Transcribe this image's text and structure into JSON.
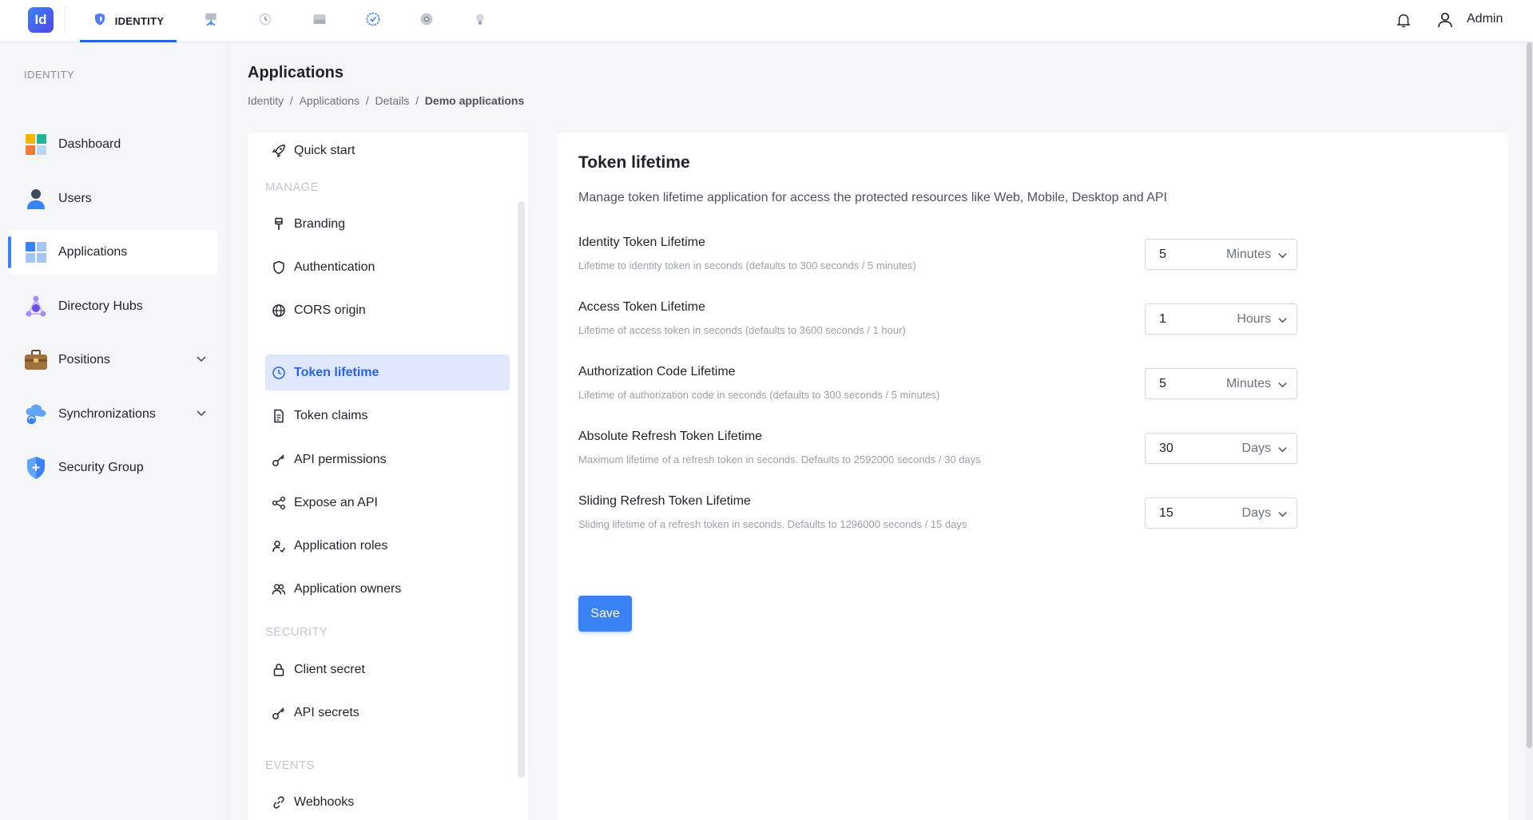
{
  "topbar": {
    "logo_text": "Id",
    "tabs": [
      {
        "name": "shield-icon",
        "label": "IDENTITY"
      },
      {
        "name": "network-icon",
        "label": ""
      },
      {
        "name": "history-icon",
        "label": ""
      },
      {
        "name": "storage-icon",
        "label": ""
      },
      {
        "name": "badge-check-icon",
        "label": ""
      },
      {
        "name": "gear-icon",
        "label": ""
      },
      {
        "name": "lightbulb-icon",
        "label": ""
      }
    ],
    "user_label": "Admin"
  },
  "sidebar": {
    "section": "IDENTITY",
    "items": [
      {
        "label": "Dashboard",
        "icon": "dashboard-icon"
      },
      {
        "label": "Users",
        "icon": "user-icon"
      },
      {
        "label": "Applications",
        "icon": "applications-icon",
        "active": true
      },
      {
        "label": "Directory Hubs",
        "icon": "hub-icon"
      },
      {
        "label": "Positions",
        "icon": "briefcase-icon",
        "expandable": true
      },
      {
        "label": "Synchronizations",
        "icon": "cloud-sync-icon",
        "expandable": true
      },
      {
        "label": "Security Group",
        "icon": "security-shield-icon"
      }
    ]
  },
  "header": {
    "title": "Applications",
    "breadcrumb": [
      "Identity",
      "Applications",
      "Details",
      "Demo applications"
    ],
    "separator": "/"
  },
  "nav": {
    "quick_start": "Quick start",
    "sections": {
      "manage": "MANAGE",
      "security": "SECURITY",
      "events": "EVENTS"
    },
    "manage_items": [
      "Branding",
      "Authentication",
      "CORS origin",
      "Token lifetime",
      "Token claims",
      "API permissions",
      "Expose an API",
      "Application roles",
      "Application owners"
    ],
    "security_items": [
      "Client secret",
      "API secrets"
    ],
    "events_items": [
      "Webhooks"
    ],
    "active": "Token lifetime"
  },
  "main": {
    "title": "Token lifetime",
    "description": "Manage token lifetime application for access the protected resources like Web, Mobile, Desktop and API",
    "fields": [
      {
        "label": "Identity Token Lifetime",
        "help": "Lifetime to identity token in seconds (defaults to 300 seconds / 5 minutes)",
        "value": "5",
        "unit": "Minutes"
      },
      {
        "label": "Access Token Lifetime",
        "help": "Lifetime of access token in seconds (defaults to 3600 seconds / 1 hour)",
        "value": "1",
        "unit": "Hours"
      },
      {
        "label": "Authorization Code Lifetime",
        "help": "Lifetime of authorization code in seconds (defaults to 300 seconds / 5 minutes)",
        "value": "5",
        "unit": "Minutes"
      },
      {
        "label": "Absolute Refresh Token Lifetime",
        "help": "Maximum lifetime of a refresh token in seconds. Defaults to 2592000 seconds / 30 days",
        "value": "30",
        "unit": "Days"
      },
      {
        "label": "Sliding Refresh Token Lifetime",
        "help": "Sliding lifetime of a refresh token in seconds. Defaults to 1296000 seconds / 15 days",
        "value": "15",
        "unit": "Days"
      }
    ],
    "save_label": "Save"
  },
  "colors": {
    "accent": "#3b82f6",
    "active_nav_bg": "#dfe8ff"
  }
}
